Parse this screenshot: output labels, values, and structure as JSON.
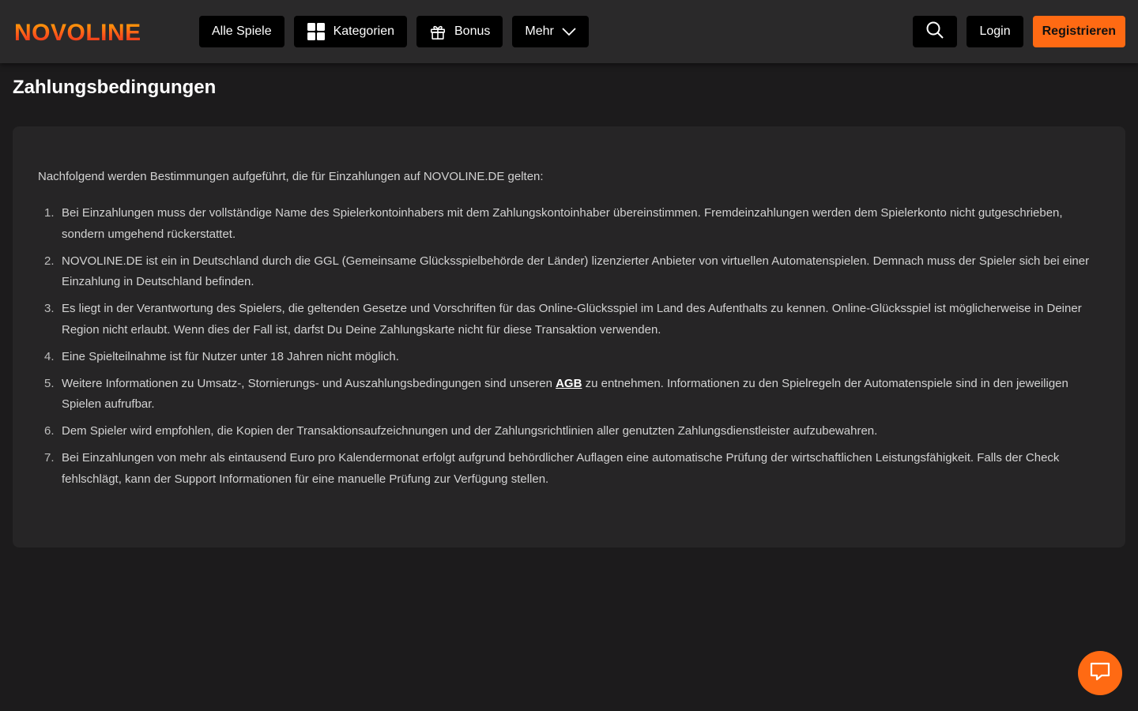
{
  "header": {
    "logo_text": "NOVOLINE",
    "nav": {
      "all_games": "Alle Spiele",
      "categories": "Kategorien",
      "bonus": "Bonus",
      "more": "Mehr"
    },
    "login": "Login",
    "register": "Registrieren"
  },
  "page": {
    "title": "Zahlungsbedingungen",
    "intro": "Nachfolgend werden Bestimmungen aufgeführt, die für Einzahlungen auf NOVOLINE.DE gelten:",
    "items": [
      {
        "num": "1.",
        "text": "Bei Einzahlungen muss der vollständige Name des Spielerkontoinhabers mit dem Zahlungskontoinhaber übereinstimmen. Fremdeinzahlungen werden dem Spielerkonto nicht gutgeschrieben, sondern umgehend rückerstattet."
      },
      {
        "num": "2.",
        "text": "NOVOLINE.DE ist ein in Deutschland durch die GGL (Gemeinsame Glücksspielbehörde der Länder) lizenzierter Anbieter von virtuellen Automatenspielen. Demnach muss der Spieler sich bei einer Einzahlung in Deutschland befinden."
      },
      {
        "num": "3.",
        "text": "Es liegt in der Verantwortung des Spielers, die geltenden Gesetze und Vorschriften für das Online-Glücksspiel im Land des Aufenthalts zu kennen. Online-Glücksspiel ist möglicherweise in Deiner Region nicht erlaubt. Wenn dies der Fall ist, darfst Du Deine Zahlungskarte nicht für diese Transaktion verwenden."
      },
      {
        "num": "4.",
        "text": "Eine Spielteilnahme ist für Nutzer unter 18 Jahren nicht möglich."
      },
      {
        "num": "5.",
        "text_before": "Weitere Informationen zu Umsatz-, Stornierungs- und Auszahlungsbedingungen sind unseren ",
        "link": "AGB",
        "text_after": " zu entnehmen. Informationen zu den Spielregeln der Automatenspiele sind in den jeweiligen Spielen aufrufbar."
      },
      {
        "num": "6.",
        "text": "Dem Spieler wird empfohlen, die Kopien der Transaktionsaufzeichnungen und der Zahlungsrichtlinien aller genutzten Zahlungsdienstleister aufzubewahren."
      },
      {
        "num": "7.",
        "text": "Bei Einzahlungen von mehr als eintausend Euro pro Kalendermonat erfolgt aufgrund behördlicher Auflagen eine automatische Prüfung der wirtschaftlichen Leistungsfähigkeit. Falls der Check fehlschlägt, kann der Support Informationen für eine manuelle Prüfung zur Verfügung stellen."
      }
    ]
  },
  "icons": {
    "categories": "grid-icon",
    "bonus": "gift-icon",
    "more": "chevron-down-icon",
    "search": "search-icon",
    "chat": "chat-icon"
  },
  "colors": {
    "accent": "#ff6a13",
    "background": "#1c1b1c",
    "header": "#2a292a",
    "card": "#262526"
  }
}
